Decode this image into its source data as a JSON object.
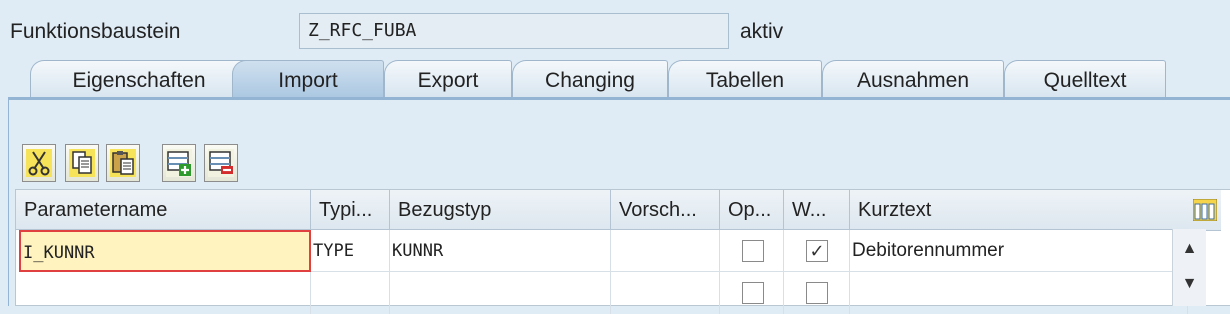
{
  "header": {
    "label": "Funktionsbaustein",
    "value": "Z_RFC_FUBA",
    "status": "aktiv"
  },
  "tabs": [
    {
      "label": "Eigenschaften",
      "active": false
    },
    {
      "label": "Import",
      "active": true
    },
    {
      "label": "Export",
      "active": false
    },
    {
      "label": "Changing",
      "active": false
    },
    {
      "label": "Tabellen",
      "active": false
    },
    {
      "label": "Ausnahmen",
      "active": false
    },
    {
      "label": "Quelltext",
      "active": false
    }
  ],
  "toolbar": {
    "buttons": [
      "cut-icon",
      "copy-icon",
      "paste-icon",
      "insert-row-icon",
      "delete-row-icon"
    ]
  },
  "table": {
    "columns": [
      "Parametername",
      "Typi...",
      "Bezugstyp",
      "Vorsch...",
      "Op...",
      "W...",
      "Kurztext"
    ],
    "rows": [
      {
        "name": "I_KUNNR",
        "typing": "TYPE",
        "ref": "KUNNR",
        "default": "",
        "optional": false,
        "pass_value": true,
        "text": "Debitorennummer"
      },
      {
        "name": "",
        "typing": "",
        "ref": "",
        "default": "",
        "optional": false,
        "pass_value": false,
        "text": ""
      }
    ]
  }
}
